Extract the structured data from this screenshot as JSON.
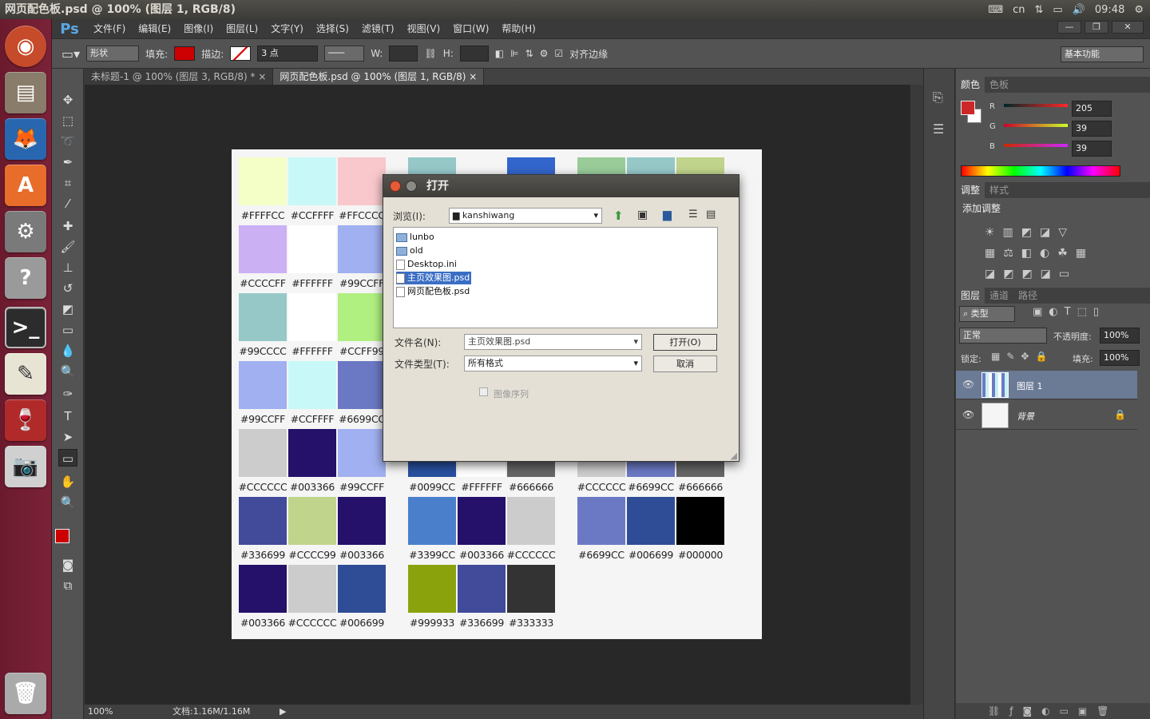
{
  "top_bar": {
    "title": "网页配色板.psd @ 100% (图层 1, RGB/8)",
    "keyboard": "cn",
    "time": "09:48"
  },
  "launcher": {
    "items": [
      "ubuntu-logo",
      "files",
      "firefox",
      "software-center",
      "system-settings",
      "help",
      "terminal",
      "text-editor",
      "wine",
      "camera",
      "trash"
    ]
  },
  "menu": {
    "logo": "Ps",
    "items": [
      "文件(F)",
      "编辑(E)",
      "图像(I)",
      "图层(L)",
      "文字(Y)",
      "选择(S)",
      "滤镜(T)",
      "视图(V)",
      "窗口(W)",
      "帮助(H)"
    ]
  },
  "options": {
    "mode": "形状",
    "fill_label": "填充:",
    "fill_color": "#cc0000",
    "stroke_label": "描边:",
    "stroke_size": "3 点",
    "w_label": "W:",
    "h_label": "H:",
    "align_edges": "对齐边缘",
    "workspace": "基本功能"
  },
  "tabs": [
    {
      "label": "未标题-1 @ 100% (图层 3, RGB/8) *",
      "close": "×"
    },
    {
      "label": "网页配色板.psd @ 100% (图层 1, RGB/8)",
      "close": "×"
    }
  ],
  "status": {
    "zoom": "100%",
    "doc": "文档:1.16M/1.16M"
  },
  "palette": {
    "rows": [
      [
        {
          "hex": "#FFFFCC",
          "label": "#FFFFCC"
        },
        {
          "hex": "#CCFFFF",
          "label": "#CCFFFF"
        },
        {
          "hex": "#FFCCCC",
          "label": "#FFCCCC"
        },
        {
          "hex": "#99CCCC",
          "label": ""
        },
        {
          "hex": "#F5F5F5",
          "label": ""
        },
        {
          "hex": "#3366CC",
          "label": ""
        },
        {
          "hex": "#99CC99",
          "label": ""
        },
        {
          "hex": "#99CCCC",
          "label": ""
        },
        {
          "hex": "#CCCC99",
          "label": ""
        }
      ],
      [
        {
          "hex": "#CCCCFF",
          "label": "#CCCCFF"
        },
        {
          "hex": "#FFFFFF",
          "label": "#FFFFFF"
        },
        {
          "hex": "#99CCFF",
          "label": "#99CCFF"
        }
      ],
      [
        {
          "hex": "#99CCCC",
          "label": "#99CCCC"
        },
        {
          "hex": "#FFFFFF",
          "label": "#FFFFFF"
        },
        {
          "hex": "#CCFF99",
          "label": "#CCFF99"
        }
      ],
      [
        {
          "hex": "#99CCFF",
          "label": "#99CCFF"
        },
        {
          "hex": "#CCFFFF",
          "label": "#CCFFFF"
        },
        {
          "hex": "#6699CC",
          "label": "#6699CC"
        }
      ],
      [
        {
          "hex": "#CCCCCC",
          "label": "#CCCCCC"
        },
        {
          "hex": "#003366",
          "label": "#003366"
        },
        {
          "hex": "#99CCFF",
          "label": "#99CCFF"
        },
        {
          "hex": "#0099CC",
          "label": "#0099CC"
        },
        {
          "hex": "#FFFFFF",
          "label": "#FFFFFF"
        },
        {
          "hex": "#666666",
          "label": "#666666"
        },
        {
          "hex": "#CCCCCC",
          "label": "#CCCCCC"
        },
        {
          "hex": "#6699CC",
          "label": "#6699CC"
        },
        {
          "hex": "#666666",
          "label": "#666666"
        }
      ],
      [
        {
          "hex": "#336699",
          "label": "#336699"
        },
        {
          "hex": "#CCCC99",
          "label": "#CCCC99"
        },
        {
          "hex": "#003366",
          "label": "#003366"
        },
        {
          "hex": "#3399CC",
          "label": "#3399CC"
        },
        {
          "hex": "#003366",
          "label": "#003366"
        },
        {
          "hex": "#CCCCCC",
          "label": "#CCCCCC"
        },
        {
          "hex": "#6699CC",
          "label": "#6699CC"
        },
        {
          "hex": "#006699",
          "label": "#006699"
        },
        {
          "hex": "#000000",
          "label": "#000000"
        }
      ],
      [
        {
          "hex": "#003366",
          "label": "#003366"
        },
        {
          "hex": "#CCCCCC",
          "label": "#CCCCCC"
        },
        {
          "hex": "#006699",
          "label": "#006699"
        },
        {
          "hex": "#999933",
          "label": "#999933"
        },
        {
          "hex": "#336699",
          "label": "#336699"
        },
        {
          "hex": "#333333",
          "label": "#333333"
        }
      ]
    ],
    "display_colors": {
      "#003366": "#25106a",
      "#336699": "#424a9a",
      "#006699": "#2f4d96",
      "#3399CC": "#4a7fcc",
      "#6699CC": "#6b79c4",
      "#999933": "#8aa30c",
      "#CCCC99": "#c0d48c",
      "#99CCCC": "#96c8c8",
      "#99CCFF": "#a0b0f0",
      "#CCCCFF": "#ccb0f4",
      "#CCFF99": "#b0f080",
      "#CCFFFF": "#c8f8f8",
      "#FFCCCC": "#f8c8cc",
      "#FFFFCC": "#f4ffc8",
      "#0099CC": "#2850a0"
    }
  },
  "color_panel": {
    "tabs": [
      "颜色",
      "色板"
    ],
    "r_label": "R",
    "g_label": "G",
    "b_label": "B",
    "r": "205",
    "g": "39",
    "b": "39",
    "fg": "#cd2727"
  },
  "adjust_panel": {
    "tabs": [
      "调整",
      "样式"
    ],
    "title": "添加调整"
  },
  "layers_panel": {
    "tabs": [
      "图层",
      "通道",
      "路径"
    ],
    "filter": "类型",
    "blend": "正常",
    "opacity_label": "不透明度:",
    "opacity": "100%",
    "lock_label": "锁定:",
    "fill_label": "填充:",
    "fill": "100%",
    "layers": [
      {
        "name": "图层 1"
      },
      {
        "name": "背景"
      }
    ]
  },
  "dialog": {
    "title": "打开",
    "browse_label": "浏览(I):",
    "folder": "kanshiwang",
    "files": [
      {
        "name": "lunbo",
        "type": "folder"
      },
      {
        "name": "old",
        "type": "folder"
      },
      {
        "name": "Desktop.ini",
        "type": "file"
      },
      {
        "name": "主页效果图.psd",
        "type": "file",
        "selected": true
      },
      {
        "name": "网页配色板.psd",
        "type": "file"
      }
    ],
    "filename_label": "文件名(N):",
    "filename": "主页效果图.psd",
    "filetype_label": "文件类型(T):",
    "filetype": "所有格式",
    "open_button": "打开(O)",
    "cancel_button": "取消",
    "image_sequence": "图像序列"
  }
}
